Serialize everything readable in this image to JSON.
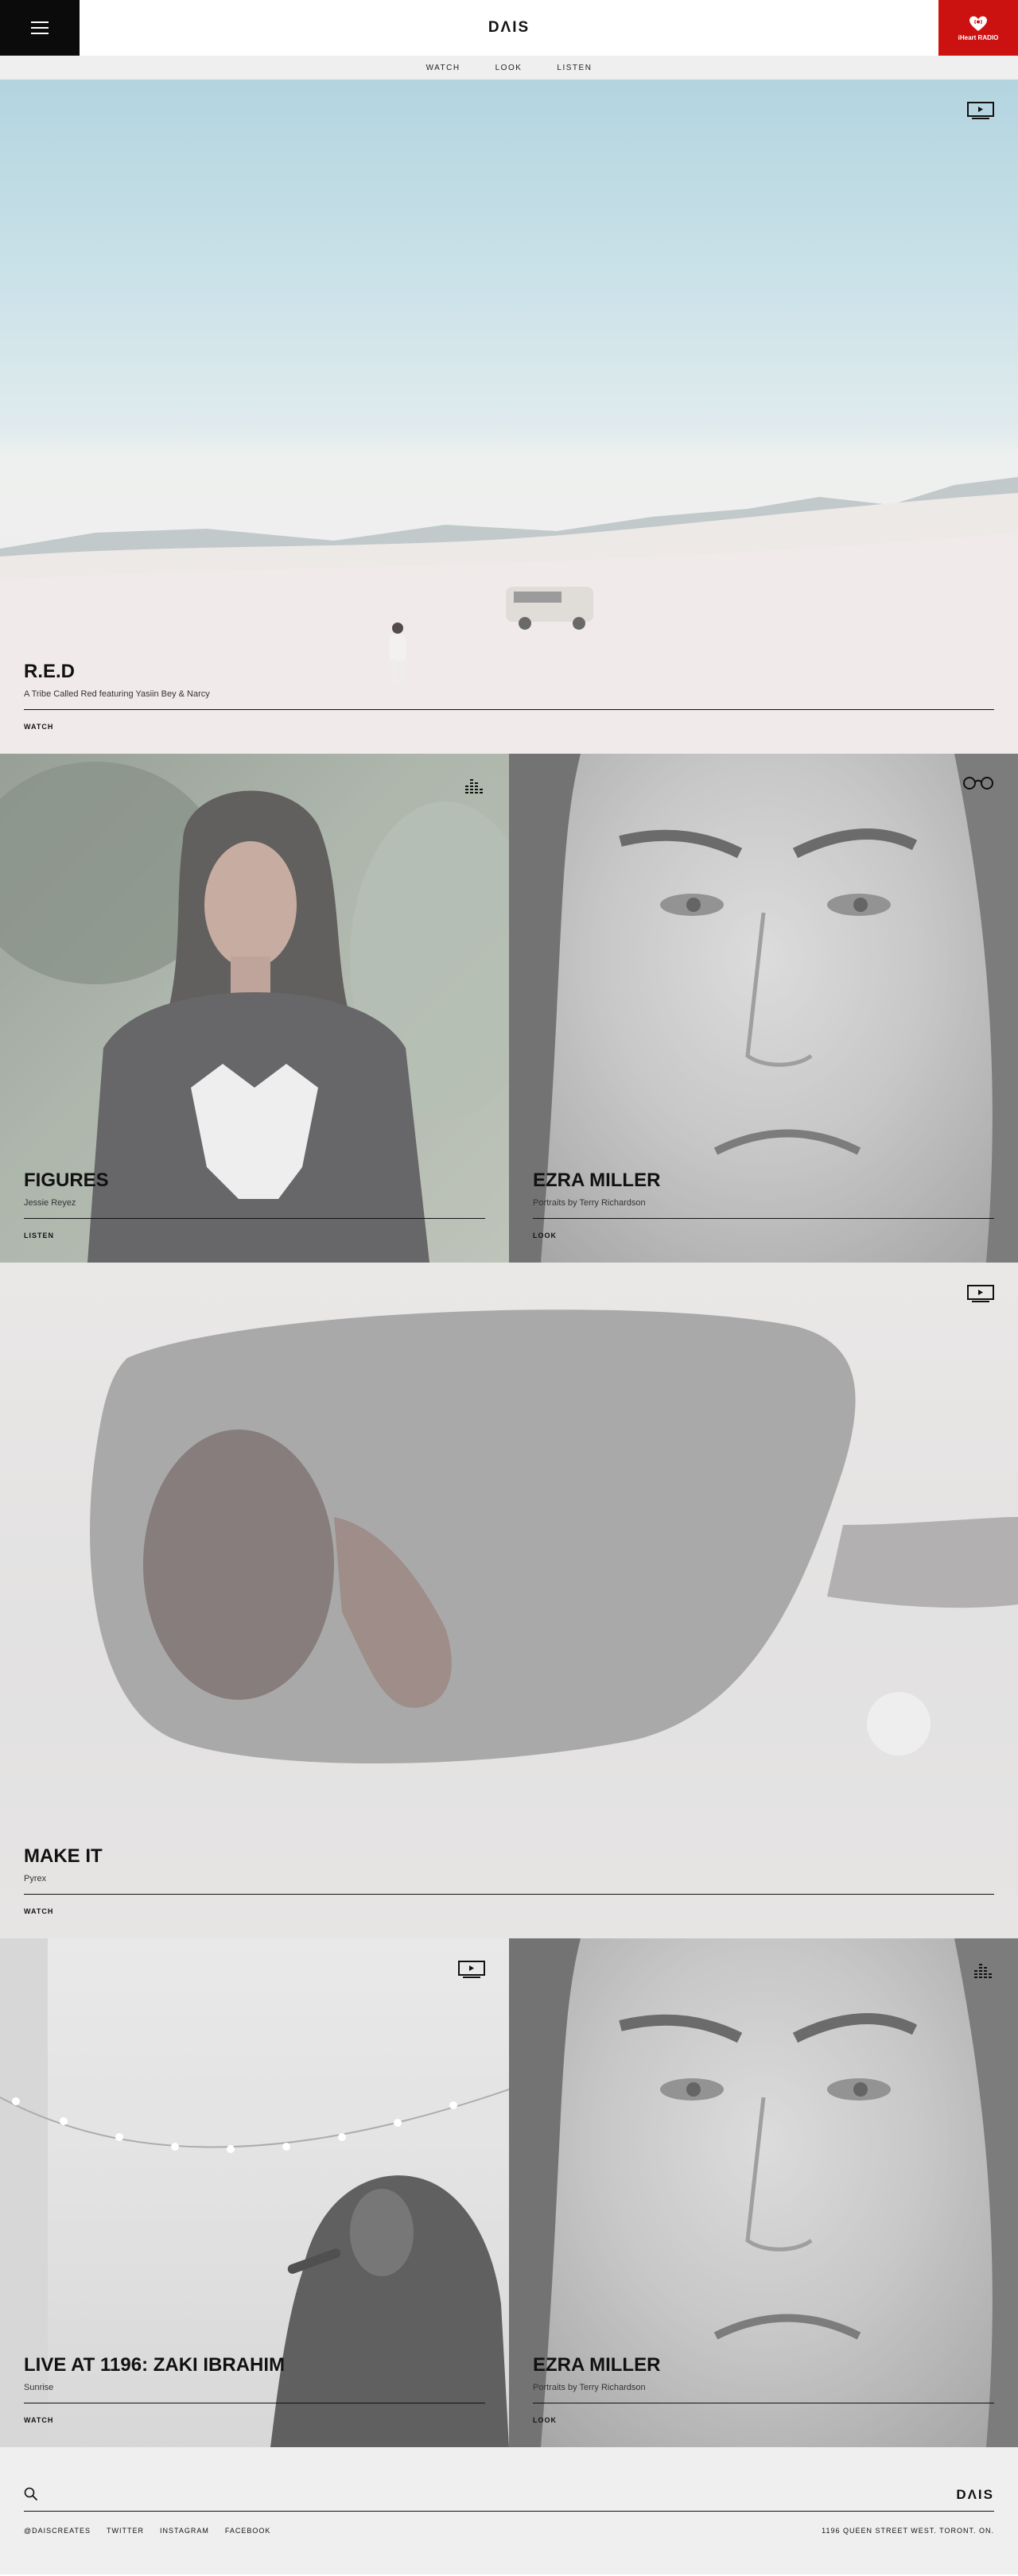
{
  "header": {
    "logo": "DΛIS",
    "radio_label": "iHeart RADIO"
  },
  "subnav": {
    "items": [
      "WATCH",
      "LOOK",
      "LISTEN"
    ]
  },
  "tiles": {
    "red": {
      "title": "R.E.D",
      "subtitle": "A Tribe Called Red featuring Yasiin Bey & Narcy",
      "cta": "WATCH",
      "icon": "tv-icon"
    },
    "figures": {
      "title": "FIGURES",
      "subtitle": "Jessie Reyez",
      "cta": "LISTEN",
      "icon": "equalizer-icon"
    },
    "ezra1": {
      "title": "EZRA MILLER",
      "subtitle": "Portraits by Terry Richardson",
      "cta": "LOOK",
      "icon": "glasses-icon"
    },
    "makeit": {
      "title": "MAKE IT",
      "subtitle": "Pyrex",
      "cta": "WATCH",
      "icon": "tv-icon"
    },
    "live": {
      "title": "LIVE AT 1196: ZAKI IBRAHIM",
      "subtitle": "Sunrise",
      "cta": "WATCH",
      "icon": "tv-icon"
    },
    "ezra2": {
      "title": "EZRA MILLER",
      "subtitle": "Portraits by Terry Richardson",
      "cta": "LOOK",
      "icon": "equalizer-icon"
    }
  },
  "footer": {
    "logo": "DΛIS",
    "links": [
      "@DAISCREATES",
      "TWITTER",
      "INSTAGRAM",
      "FACEBOOK"
    ],
    "address": "1196 QUEEN STREET WEST. TORONT. ON."
  },
  "colors": {
    "menu_bg": "#0b0b0b",
    "radio_bg": "#cc1111",
    "subnav_bg": "#efefef",
    "footer_bg": "#efefef"
  }
}
